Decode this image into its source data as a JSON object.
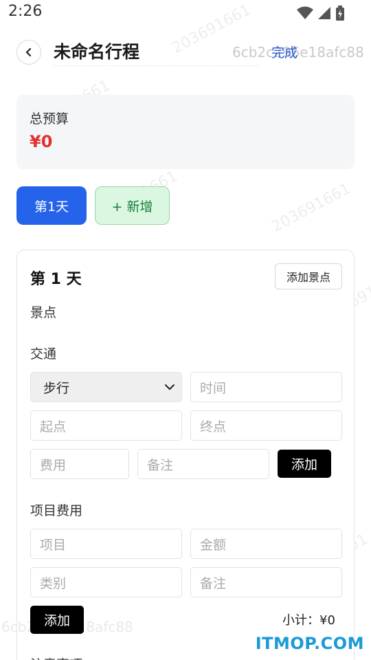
{
  "status": {
    "time": "2:26"
  },
  "header": {
    "title": "未命名行程",
    "trip_id": "6cb2c296e18afc88",
    "done_label": "完成"
  },
  "budget": {
    "label": "总预算",
    "value": "¥0",
    "value_color": "#e03232"
  },
  "tabs": {
    "active_day": "第1天",
    "add_label": "+ 新增"
  },
  "day": {
    "heading": "第 1 天",
    "add_spot_label": "添加景点",
    "spots_label": "景点",
    "transport_label": "交通",
    "transport": {
      "mode_value": "步行",
      "time_placeholder": "时间",
      "start_placeholder": "起点",
      "end_placeholder": "终点",
      "cost_placeholder": "费用",
      "note_placeholder": "备注",
      "add_label": "添加"
    },
    "expense_label": "项目费用",
    "expense": {
      "item_placeholder": "项目",
      "amount_placeholder": "金额",
      "category_placeholder": "类别",
      "note_placeholder": "备注",
      "add_label": "添加",
      "subtotal": "小计：¥0"
    },
    "notes_label": "注意事项"
  },
  "watermark": {
    "text": "203691661",
    "id_text": "6cb2c296e18afc88"
  },
  "logo": "ITMOP.COM",
  "colors": {
    "primary": "#2563eb",
    "success_bg": "#dcf7e1",
    "success_text": "#17803d",
    "accent_link": "#2a5bd7"
  }
}
